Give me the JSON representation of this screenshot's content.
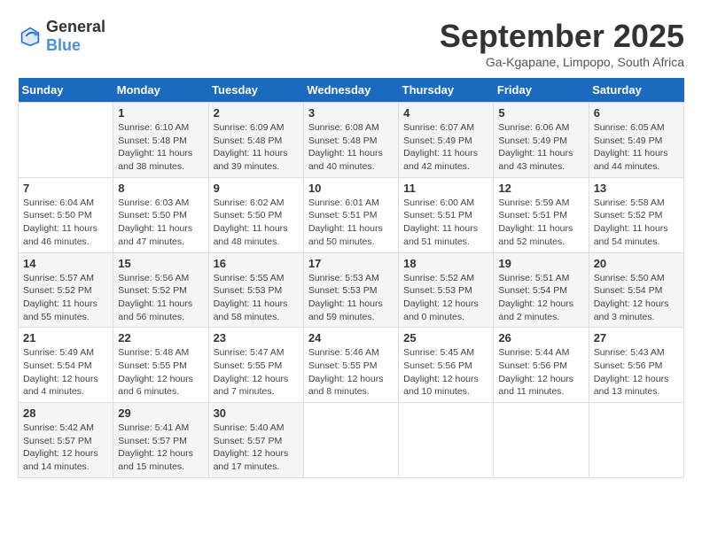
{
  "header": {
    "logo_general": "General",
    "logo_blue": "Blue",
    "title": "September 2025",
    "subtitle": "Ga-Kgapane, Limpopo, South Africa"
  },
  "days_of_week": [
    "Sunday",
    "Monday",
    "Tuesday",
    "Wednesday",
    "Thursday",
    "Friday",
    "Saturday"
  ],
  "weeks": [
    [
      {
        "day": "",
        "content": ""
      },
      {
        "day": "1",
        "content": "Sunrise: 6:10 AM\nSunset: 5:48 PM\nDaylight: 11 hours\nand 38 minutes."
      },
      {
        "day": "2",
        "content": "Sunrise: 6:09 AM\nSunset: 5:48 PM\nDaylight: 11 hours\nand 39 minutes."
      },
      {
        "day": "3",
        "content": "Sunrise: 6:08 AM\nSunset: 5:48 PM\nDaylight: 11 hours\nand 40 minutes."
      },
      {
        "day": "4",
        "content": "Sunrise: 6:07 AM\nSunset: 5:49 PM\nDaylight: 11 hours\nand 42 minutes."
      },
      {
        "day": "5",
        "content": "Sunrise: 6:06 AM\nSunset: 5:49 PM\nDaylight: 11 hours\nand 43 minutes."
      },
      {
        "day": "6",
        "content": "Sunrise: 6:05 AM\nSunset: 5:49 PM\nDaylight: 11 hours\nand 44 minutes."
      }
    ],
    [
      {
        "day": "7",
        "content": "Sunrise: 6:04 AM\nSunset: 5:50 PM\nDaylight: 11 hours\nand 46 minutes."
      },
      {
        "day": "8",
        "content": "Sunrise: 6:03 AM\nSunset: 5:50 PM\nDaylight: 11 hours\nand 47 minutes."
      },
      {
        "day": "9",
        "content": "Sunrise: 6:02 AM\nSunset: 5:50 PM\nDaylight: 11 hours\nand 48 minutes."
      },
      {
        "day": "10",
        "content": "Sunrise: 6:01 AM\nSunset: 5:51 PM\nDaylight: 11 hours\nand 50 minutes."
      },
      {
        "day": "11",
        "content": "Sunrise: 6:00 AM\nSunset: 5:51 PM\nDaylight: 11 hours\nand 51 minutes."
      },
      {
        "day": "12",
        "content": "Sunrise: 5:59 AM\nSunset: 5:51 PM\nDaylight: 11 hours\nand 52 minutes."
      },
      {
        "day": "13",
        "content": "Sunrise: 5:58 AM\nSunset: 5:52 PM\nDaylight: 11 hours\nand 54 minutes."
      }
    ],
    [
      {
        "day": "14",
        "content": "Sunrise: 5:57 AM\nSunset: 5:52 PM\nDaylight: 11 hours\nand 55 minutes."
      },
      {
        "day": "15",
        "content": "Sunrise: 5:56 AM\nSunset: 5:52 PM\nDaylight: 11 hours\nand 56 minutes."
      },
      {
        "day": "16",
        "content": "Sunrise: 5:55 AM\nSunset: 5:53 PM\nDaylight: 11 hours\nand 58 minutes."
      },
      {
        "day": "17",
        "content": "Sunrise: 5:53 AM\nSunset: 5:53 PM\nDaylight: 11 hours\nand 59 minutes."
      },
      {
        "day": "18",
        "content": "Sunrise: 5:52 AM\nSunset: 5:53 PM\nDaylight: 12 hours\nand 0 minutes."
      },
      {
        "day": "19",
        "content": "Sunrise: 5:51 AM\nSunset: 5:54 PM\nDaylight: 12 hours\nand 2 minutes."
      },
      {
        "day": "20",
        "content": "Sunrise: 5:50 AM\nSunset: 5:54 PM\nDaylight: 12 hours\nand 3 minutes."
      }
    ],
    [
      {
        "day": "21",
        "content": "Sunrise: 5:49 AM\nSunset: 5:54 PM\nDaylight: 12 hours\nand 4 minutes."
      },
      {
        "day": "22",
        "content": "Sunrise: 5:48 AM\nSunset: 5:55 PM\nDaylight: 12 hours\nand 6 minutes."
      },
      {
        "day": "23",
        "content": "Sunrise: 5:47 AM\nSunset: 5:55 PM\nDaylight: 12 hours\nand 7 minutes."
      },
      {
        "day": "24",
        "content": "Sunrise: 5:46 AM\nSunset: 5:55 PM\nDaylight: 12 hours\nand 8 minutes."
      },
      {
        "day": "25",
        "content": "Sunrise: 5:45 AM\nSunset: 5:56 PM\nDaylight: 12 hours\nand 10 minutes."
      },
      {
        "day": "26",
        "content": "Sunrise: 5:44 AM\nSunset: 5:56 PM\nDaylight: 12 hours\nand 11 minutes."
      },
      {
        "day": "27",
        "content": "Sunrise: 5:43 AM\nSunset: 5:56 PM\nDaylight: 12 hours\nand 13 minutes."
      }
    ],
    [
      {
        "day": "28",
        "content": "Sunrise: 5:42 AM\nSunset: 5:57 PM\nDaylight: 12 hours\nand 14 minutes."
      },
      {
        "day": "29",
        "content": "Sunrise: 5:41 AM\nSunset: 5:57 PM\nDaylight: 12 hours\nand 15 minutes."
      },
      {
        "day": "30",
        "content": "Sunrise: 5:40 AM\nSunset: 5:57 PM\nDaylight: 12 hours\nand 17 minutes."
      },
      {
        "day": "",
        "content": ""
      },
      {
        "day": "",
        "content": ""
      },
      {
        "day": "",
        "content": ""
      },
      {
        "day": "",
        "content": ""
      }
    ]
  ]
}
